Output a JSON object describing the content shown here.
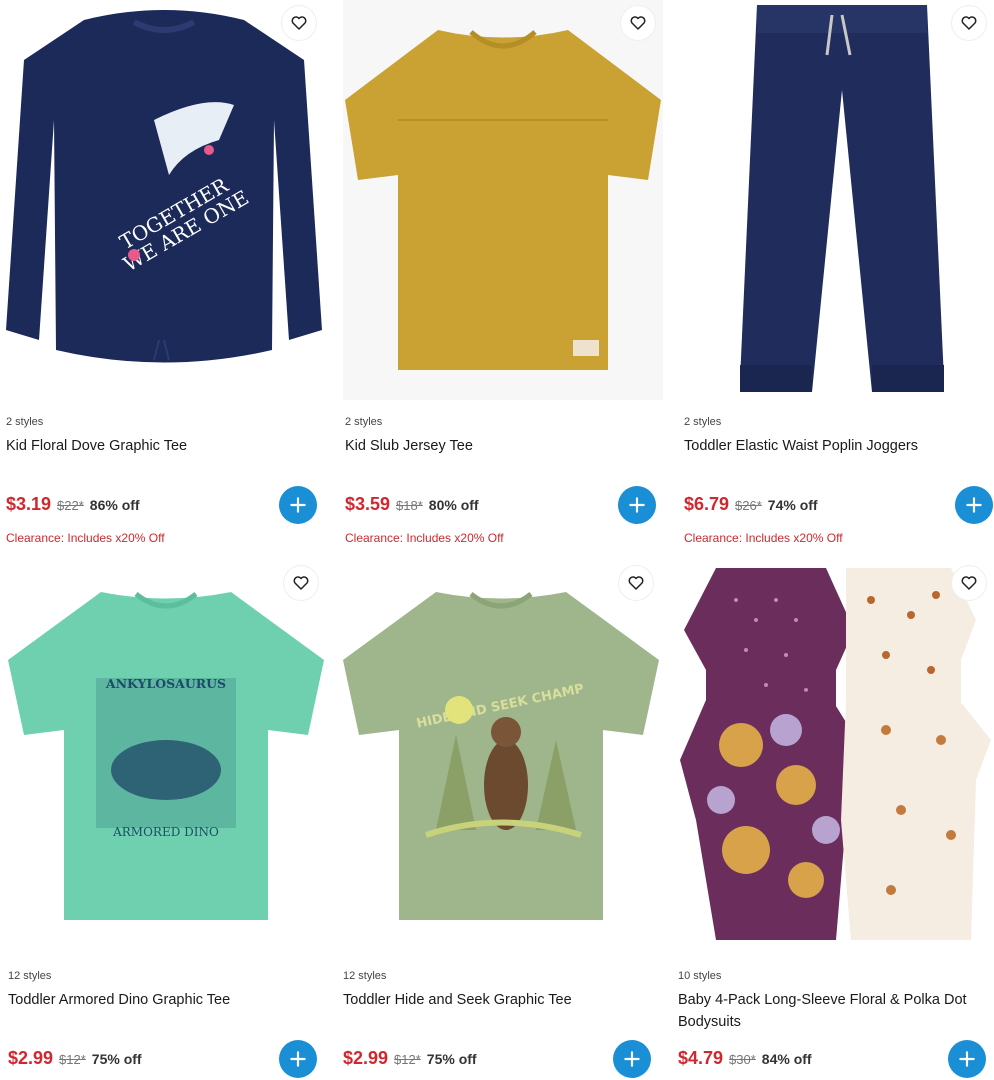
{
  "products": [
    {
      "styles": "2 styles",
      "title": "Kid Floral Dove Graphic Tee",
      "sale": "$3.19",
      "orig": "$22*",
      "pct": "86% off",
      "clearance": "Clearance: Includes x20% Off",
      "graphic_text": [
        "TOGETHER",
        "WE ARE ONE"
      ],
      "garment_color": "#1c2a5a"
    },
    {
      "styles": "2 styles",
      "title": "Kid Slub Jersey Tee",
      "sale": "$3.59",
      "orig": "$18*",
      "pct": "80% off",
      "clearance": "Clearance: Includes x20% Off",
      "garment_color": "#c9a233"
    },
    {
      "styles": "2 styles",
      "title": "Toddler Elastic Waist Poplin Joggers",
      "sale": "$6.79",
      "orig": "$26*",
      "pct": "74% off",
      "clearance": "Clearance: Includes x20% Off",
      "garment_color": "#1f2c5c"
    },
    {
      "styles": "12 styles",
      "title": "Toddler Armored Dino Graphic Tee",
      "sale": "$2.99",
      "orig": "$12*",
      "pct": "75% off",
      "graphic_text": [
        "ANKYLOSAURUS",
        "ARMORED DINO"
      ],
      "garment_color": "#6fd0b0"
    },
    {
      "styles": "12 styles",
      "title": "Toddler Hide and Seek Graphic Tee",
      "sale": "$2.99",
      "orig": "$12*",
      "pct": "75% off",
      "graphic_text": [
        "HIDE AND SEEK CHAMP"
      ],
      "garment_color": "#9fb58c"
    },
    {
      "styles": "10 styles",
      "title": "Baby 4-Pack Long-Sleeve Floral & Polka Dot Bodysuits",
      "sale": "$4.79",
      "orig": "$30*",
      "pct": "84% off",
      "garment_color": "#6b2d5c"
    }
  ],
  "colors": {
    "sale": "#d0282e",
    "add_button": "#1a8fd6"
  },
  "icons": {
    "favorite": "heart-outline-icon",
    "add": "plus-icon"
  }
}
